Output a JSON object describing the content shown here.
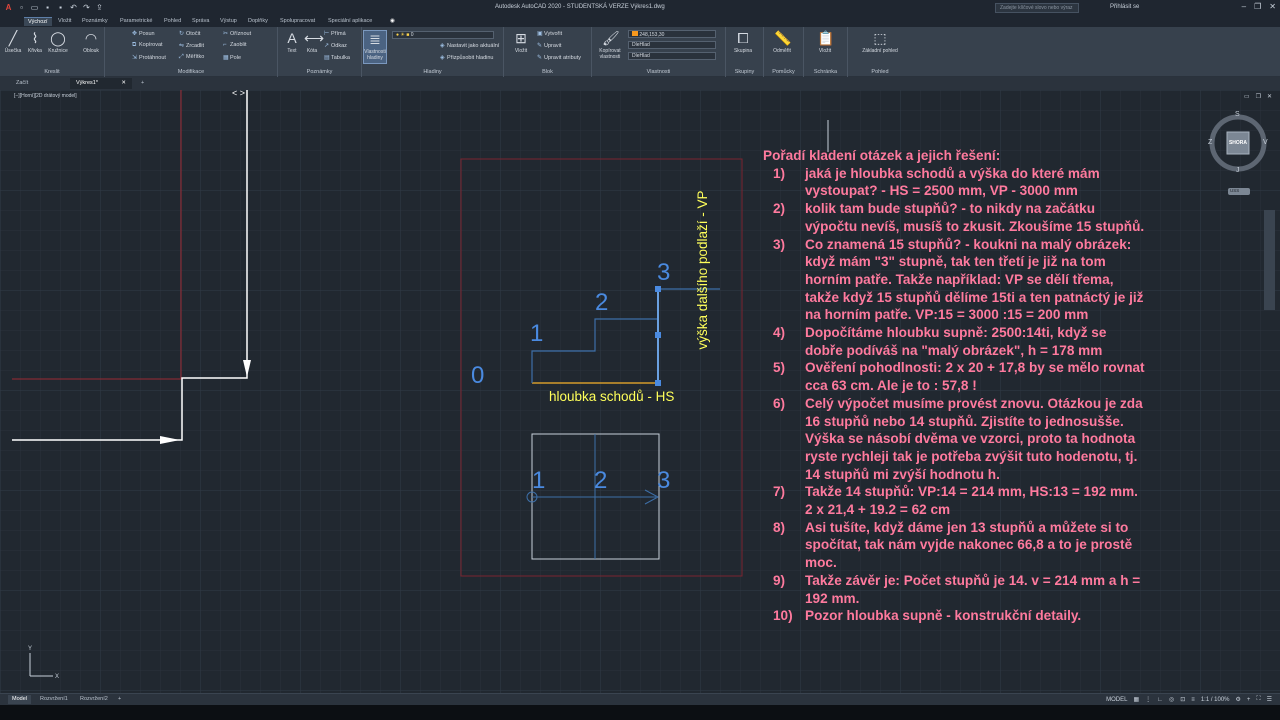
{
  "app": {
    "title": "Autodesk AutoCAD 2020 - STUDENTSKÁ VERZE    Výkres1.dwg",
    "search_placeholder": "Zadejte klíčové slovo nebo výraz",
    "signin": "Přihlásit se"
  },
  "ribbon_tabs": [
    "Výchozí",
    "Vložit",
    "Poznámky",
    "Parametrické",
    "Pohled",
    "Správa",
    "Výstup",
    "Doplňky",
    "Spolupracovat",
    "Speciální aplikace"
  ],
  "ribbon": {
    "draw": {
      "label": "Kreslit",
      "line": "Úsečka",
      "polyline": "Křivka",
      "circle": "Kružnice",
      "arc": "Oblouk"
    },
    "modify": {
      "label": "Modifikace",
      "move": "Posun",
      "rotate": "Otočit",
      "trim": "Oříznout",
      "copy": "Kopírovat",
      "mirror": "Zrcadlit",
      "fillet": "Zaoblit",
      "stretch": "Protáhnout",
      "scale": "Měřítko",
      "array": "Pole"
    },
    "annotation": {
      "label": "Poznámky",
      "text": "Text",
      "dimension": "Kóta",
      "linear": "Přímá",
      "leader": "Odkaz",
      "table": "Tabulka"
    },
    "layers": {
      "label": "Hladiny",
      "props": "Vlastnosti hladiny",
      "current_layer": "0",
      "make_current": "Nastavit jako aktuální",
      "match": "Přizpůsobit hladinu"
    },
    "block": {
      "label": "Blok",
      "insert": "Vložit",
      "create": "Vytvořit",
      "edit": "Upravit",
      "edit_attr": "Upravit atributy"
    },
    "properties": {
      "label": "Vlastnosti",
      "match": "Kopírovat vlastnosti",
      "color": "248,153,30",
      "linetype": "DleHlad",
      "lineweight": "DleHlad"
    },
    "groups": {
      "label": "Skupiny",
      "group": "Skupina"
    },
    "utilities": {
      "label": "Pomůcky",
      "measure": "Odměřit"
    },
    "clipboard": {
      "label": "Schránka",
      "paste": "Vložit"
    },
    "view": {
      "label": "Pohled",
      "base": "Základní pohled"
    }
  },
  "doc_tabs": [
    "Začít",
    "Výkres1*"
  ],
  "viewport_label": "[−][Horní][2D drátový model]",
  "viewcube": {
    "top": "SHORA",
    "n": "S",
    "s": "J",
    "e": "V",
    "w": "Z",
    "ucs": "USS"
  },
  "drawing": {
    "levels": [
      "0",
      "1",
      "2",
      "3"
    ],
    "label_depth": "hloubka schodů - HS",
    "label_height": "výška dalšího podlaží - VP",
    "plan_numbers": [
      "1",
      "2",
      "3"
    ]
  },
  "notes": {
    "heading": "Pořadí kladení otázek a jejich řešení:",
    "items": [
      {
        "n": "1)",
        "t": "jaká je hloubka schodů a výška do které mám vystoupat? - HS = 2500 mm, VP - 3000 mm"
      },
      {
        "n": "2)",
        "t": "kolik tam bude stupňů? - to nikdy na začátku výpočtu nevíš, musíš to zkusit. Zkoušíme 15 stupňů."
      },
      {
        "n": "3)",
        "t": "Co znamená 15 stupňů? - koukni na malý obrázek: když mám \"3\" stupně, tak ten třetí je již na tom horním patře. Takže například: VP se dělí třema, takže když 15 stupňů dělíme 15ti a ten patnáctý je již na horním patře. VP:15 = 3000 :15 = 200 mm"
      },
      {
        "n": "4)",
        "t": "Dopočítáme hloubku supně: 2500:14ti, když se dobře podíváš na \"malý obrázek\", h = 178 mm"
      },
      {
        "n": "5)",
        "t": "Ověření pohodlnosti: 2 x 20 + 17,8 by se mělo rovnat cca 63 cm. Ale je to : 57,8 !"
      },
      {
        "n": "6)",
        "t": "Celý výpočet musíme provést znovu. Otázkou je zda 16 stupňů nebo 14 stupňů. Zjistíte to jednosušše. Výška se násobí dvěma ve vzorci, proto ta hodnota ryste rychleji tak je potřeba zvýšit tuto hodenotu, tj. 14 stupňů mi zvýší hodnotu h."
      },
      {
        "n": "7)",
        "t": "Takže 14 stupňů: VP:14 = 214 mm, HS:13 = 192 mm. 2 x 21,4 + 19.2 = 62 cm"
      },
      {
        "n": "8)",
        "t": "Asi tušíte, když dáme jen 13 stupňů a můžete si to spočítat, tak nám vyjde nakonec 66,8 a to je prostě moc."
      },
      {
        "n": "9)",
        "t": "Takže závěr je: Počet stupňů je 14. v = 214 mm a h = 192 mm."
      },
      {
        "n": "10)",
        "t": "Pozor hloubka supně - konstrukční detaily."
      }
    ]
  },
  "status": {
    "tabs": [
      "Model",
      "Rozvržení1",
      "Rozvržení2"
    ],
    "mode": "MODEL",
    "scale": "1:1 / 100%"
  }
}
